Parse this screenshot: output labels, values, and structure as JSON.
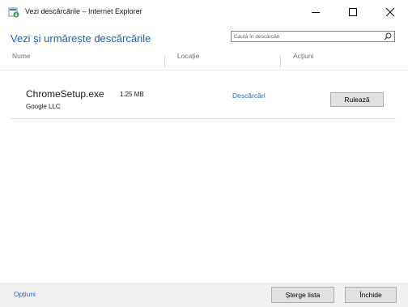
{
  "window": {
    "title": "Vezi descărcările – Internet Explorer",
    "app_icon": "ie-downloads-icon",
    "controls": [
      "minimize-icon",
      "maximize-icon",
      "close-icon"
    ]
  },
  "header": {
    "title": "Vezi și urmărește descărcările",
    "search_placeholder": "Caută în descărcări",
    "search_value": ""
  },
  "columns": [
    "Nume",
    "Locație",
    "Acțiuni"
  ],
  "downloads": [
    {
      "name": "ChromeSetup.exe",
      "size": "1.25 MB",
      "publisher": "Google LLC",
      "location": "Descărcări",
      "action": "Rulează"
    }
  ],
  "footer": {
    "options": "Opțiuni",
    "clear_list": "Șterge lista",
    "close": "Închide"
  },
  "colors": {
    "accent": "#1f5fb8",
    "link": "#2d66c6",
    "footer_bg": "#f0f0f0"
  }
}
